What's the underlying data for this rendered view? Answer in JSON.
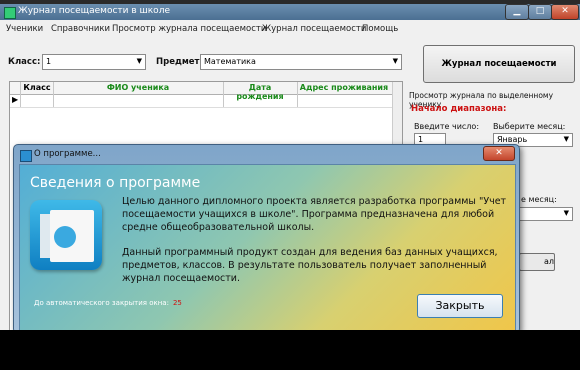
{
  "window": {
    "title": "Журнал посещаемости в школе"
  },
  "menu": [
    "Ученики",
    "Справочники",
    "Просмотр журнала посещаемости",
    "Журнал посещаемости",
    "Помощь"
  ],
  "filters": {
    "class_label": "Класс:",
    "class_value": "1",
    "subject_label": "Предмет:",
    "subject_value": "Математика"
  },
  "journal_button": "Журнал посещаемости",
  "grid": {
    "columns": [
      "Класс",
      "ФИО ученика",
      "Дата рождения",
      "Адрес проживания"
    ]
  },
  "right_panel": {
    "view_label": "Просмотр журнала по выделенному ученику",
    "range_start": "Начало диапазона:",
    "enter_number": "Введите число:",
    "number_value": "1",
    "choose_month": "Выберите месяц:",
    "month_value": "Январь",
    "month_label2": "е месяц:",
    "button_partial": "ал"
  },
  "about": {
    "title": "О программе...",
    "heading": "Сведения о программе",
    "paragraph1": "Целью данного дипломного проекта является разработка программы \"Учет посещаемости учащихся в школе\". Программа предназначена для любой средне общеобразовательной школы.",
    "paragraph2": "Данный программный продукт создан для ведения баз данных учащихся, предметов, классов. В результате пользователь получает заполненный журнал посещаемости.",
    "autoclose_label": "До автоматического закрытия окна:",
    "autoclose_count": "25",
    "close_button": "Закрыть",
    "card_label": "contacts"
  },
  "colors": {
    "accent_red": "#cc1111",
    "dialog_blue": "#53aed6",
    "dialog_yellow": "#f0c64a"
  }
}
